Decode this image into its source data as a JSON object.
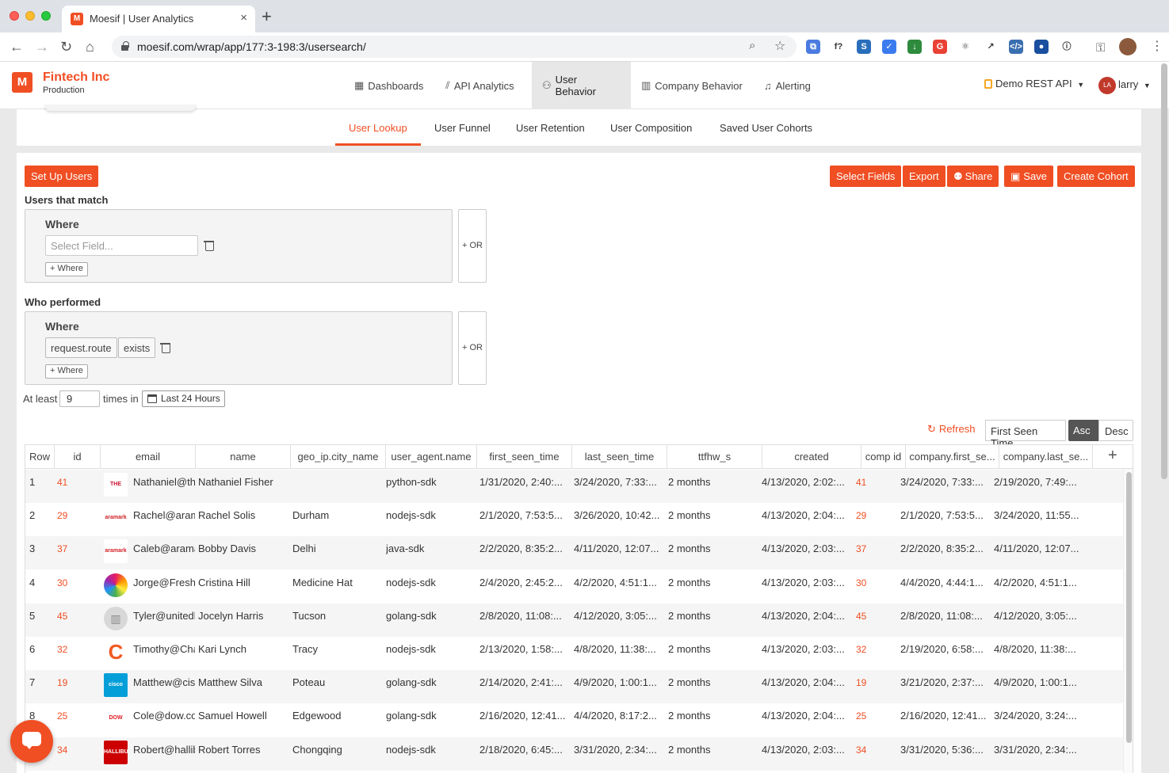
{
  "browser": {
    "tab_title": "Moesif | User Analytics",
    "tab_favicon": "M",
    "url": "moesif.com/wrap/app/177:3-198:3/usersearch/",
    "extensions": [
      {
        "name": "translate-ext-icon",
        "color": "#4a7be0",
        "glyph": "⧉"
      },
      {
        "name": "formula-ext-icon",
        "color": "#ffffff",
        "glyph": "f?"
      },
      {
        "name": "snippet-ext-icon",
        "color": "#2a6ebb",
        "glyph": "S"
      },
      {
        "name": "check-ext-icon",
        "color": "#3b7bf0",
        "glyph": "✓"
      },
      {
        "name": "bookmark-ext-icon",
        "color": "#2e8b3e",
        "glyph": "↓"
      },
      {
        "name": "google-ext-icon",
        "color": "#e94235",
        "glyph": "G"
      },
      {
        "name": "react-ext-icon",
        "color": "#ffffff",
        "glyph": "⚛"
      },
      {
        "name": "pin-ext-icon",
        "color": "#ffffff",
        "glyph": "↗"
      },
      {
        "name": "code-ext-icon",
        "color": "#3a6fb0",
        "glyph": "</>"
      },
      {
        "name": "globe-ext-icon",
        "color": "#1a4fa0",
        "glyph": "●"
      },
      {
        "name": "info-ext-icon",
        "color": "#ffffff",
        "glyph": "ⓘ"
      }
    ]
  },
  "app": {
    "org_name": "Fintech Inc",
    "environment": "Production",
    "logo_glyph": "M",
    "nav": [
      {
        "label": "Dashboards",
        "icon": "▦"
      },
      {
        "label": "API Analytics",
        "icon": "📈"
      },
      {
        "label": "User Behavior",
        "icon": "👥"
      },
      {
        "label": "Company Behavior",
        "icon": "▥"
      },
      {
        "label": "Alerting",
        "icon": "🔔"
      }
    ],
    "api_selector": "Demo REST API",
    "user_initials": "LA",
    "user_name": "larry",
    "accent_color": "#f04e23"
  },
  "subnav": [
    "User Lookup",
    "User Funnel",
    "User Retention",
    "User Composition",
    "Saved User Cohorts"
  ],
  "toolbar": {
    "setup_users": "Set Up Users",
    "select_fields": "Select Fields",
    "export": "Export",
    "share": "Share",
    "save": "Save",
    "create_cohort": "Create Cohort"
  },
  "filters": {
    "users_match_label": "Users that match",
    "who_performed_label": "Who performed",
    "where_label": "Where",
    "select_field_placeholder": "Select Field...",
    "add_where": "+ Where",
    "or_button": "+ OR",
    "performed_field": "request.route",
    "performed_operator": "exists",
    "at_least_label": "At least",
    "at_least_value": "9",
    "times_in_label": "times in",
    "date_range": "Last 24 Hours"
  },
  "sort": {
    "refresh": "Refresh",
    "field": "First Seen Time",
    "asc": "Asc",
    "desc": "Desc"
  },
  "table": {
    "columns": [
      "Row",
      "id",
      "email",
      "name",
      "geo_ip.city_name",
      "user_agent.name",
      "first_seen_time",
      "last_seen_time",
      "ttfhw_s",
      "created",
      "comp id",
      "company.first_se...",
      "company.last_se..."
    ],
    "rows": [
      {
        "row": "1",
        "id": "41",
        "email": "Nathaniel@th",
        "name": "Nathaniel Fisher",
        "city": "",
        "agent": "python-sdk",
        "first_seen": "1/31/2020, 2:40:...",
        "last_seen": "3/24/2020, 7:33:...",
        "ttfhw": "2 months",
        "created": "4/13/2020, 2:02:...",
        "comp_id": "41",
        "company_first": "3/24/2020, 7:33:...",
        "company_last": "2/19/2020, 7:49:...",
        "logo": "THE HARTFORD",
        "logo_bg": "#ffffff",
        "logo_fg": "#c8102e"
      },
      {
        "row": "2",
        "id": "29",
        "email": "Rachel@aram",
        "name": "Rachel Solis",
        "city": "Durham",
        "agent": "nodejs-sdk",
        "first_seen": "2/1/2020, 7:53:5...",
        "last_seen": "3/26/2020, 10:42...",
        "ttfhw": "2 months",
        "created": "4/13/2020, 2:04:...",
        "comp_id": "29",
        "company_first": "2/1/2020, 7:53:5...",
        "company_last": "3/24/2020, 11:55...",
        "logo": "aramark",
        "logo_bg": "#ffffff",
        "logo_fg": "#d21f26"
      },
      {
        "row": "3",
        "id": "37",
        "email": "Caleb@arama",
        "name": "Bobby Davis",
        "city": "Delhi",
        "agent": "java-sdk",
        "first_seen": "2/2/2020, 8:35:2...",
        "last_seen": "4/11/2020, 12:07...",
        "ttfhw": "2 months",
        "created": "4/13/2020, 2:03:...",
        "comp_id": "37",
        "company_first": "2/2/2020, 8:35:2...",
        "company_last": "4/11/2020, 12:07...",
        "logo": "aramark",
        "logo_bg": "#ffffff",
        "logo_fg": "#d21f26"
      },
      {
        "row": "4",
        "id": "30",
        "email": "Jorge@Freshy",
        "name": "Cristina Hill",
        "city": "Medicine Hat",
        "agent": "nodejs-sdk",
        "first_seen": "2/4/2020, 2:45:2...",
        "last_seen": "4/2/2020, 4:51:1...",
        "ttfhw": "2 months",
        "created": "4/13/2020, 2:03:...",
        "comp_id": "30",
        "company_first": "4/4/2020, 4:44:1...",
        "company_last": "4/2/2020, 4:51:1...",
        "logo": "",
        "logo_bg": "#4cb050",
        "logo_fg": "#ffffff"
      },
      {
        "row": "5",
        "id": "45",
        "email": "Tyler@unitedh",
        "name": "Jocelyn Harris",
        "city": "Tucson",
        "agent": "golang-sdk",
        "first_seen": "2/8/2020, 11:08:...",
        "last_seen": "4/12/2020, 3:05:...",
        "ttfhw": "2 months",
        "created": "4/13/2020, 2:04:...",
        "comp_id": "45",
        "company_first": "2/8/2020, 11:08:...",
        "company_last": "4/12/2020, 3:05:...",
        "logo": "▥",
        "logo_bg": "#d8d8d8",
        "logo_fg": "#888888"
      },
      {
        "row": "6",
        "id": "32",
        "email": "Timothy@Cha",
        "name": "Kari Lynch",
        "city": "Tracy",
        "agent": "nodejs-sdk",
        "first_seen": "2/13/2020, 1:58:...",
        "last_seen": "4/8/2020, 11:38:...",
        "ttfhw": "2 months",
        "created": "4/13/2020, 2:03:...",
        "comp_id": "32",
        "company_first": "2/19/2020, 6:58:...",
        "company_last": "4/8/2020, 11:38:...",
        "logo": "C",
        "logo_bg": "#ffffff",
        "logo_fg": "#f15a24"
      },
      {
        "row": "7",
        "id": "19",
        "email": "Matthew@cis",
        "name": "Matthew Silva",
        "city": "Poteau",
        "agent": "golang-sdk",
        "first_seen": "2/14/2020, 2:41:...",
        "last_seen": "4/9/2020, 1:00:1...",
        "ttfhw": "2 months",
        "created": "4/13/2020, 2:04:...",
        "comp_id": "19",
        "company_first": "3/21/2020, 2:37:...",
        "company_last": "4/9/2020, 1:00:1...",
        "logo": "cisco",
        "logo_bg": "#049fd9",
        "logo_fg": "#ffffff"
      },
      {
        "row": "8",
        "id": "25",
        "email": "Cole@dow.co",
        "name": "Samuel Howell",
        "city": "Edgewood",
        "agent": "golang-sdk",
        "first_seen": "2/16/2020, 12:41...",
        "last_seen": "4/4/2020, 8:17:2...",
        "ttfhw": "2 months",
        "created": "4/13/2020, 2:04:...",
        "comp_id": "25",
        "company_first": "2/16/2020, 12:41...",
        "company_last": "3/24/2020, 3:24:...",
        "logo": "DOW",
        "logo_bg": "#ffffff",
        "logo_fg": "#e11b22"
      },
      {
        "row": "",
        "id": "34",
        "email": "Robert@hallib",
        "name": "Robert Torres",
        "city": "Chongqing",
        "agent": "nodejs-sdk",
        "first_seen": "2/18/2020, 6:45:...",
        "last_seen": "3/31/2020, 2:34:...",
        "ttfhw": "2 months",
        "created": "4/13/2020, 2:03:...",
        "comp_id": "34",
        "company_first": "3/31/2020, 5:36:...",
        "company_last": "3/31/2020, 2:34:...",
        "logo": "HALLIBURTON",
        "logo_bg": "#cc0000",
        "logo_fg": "#ffffff"
      }
    ]
  }
}
